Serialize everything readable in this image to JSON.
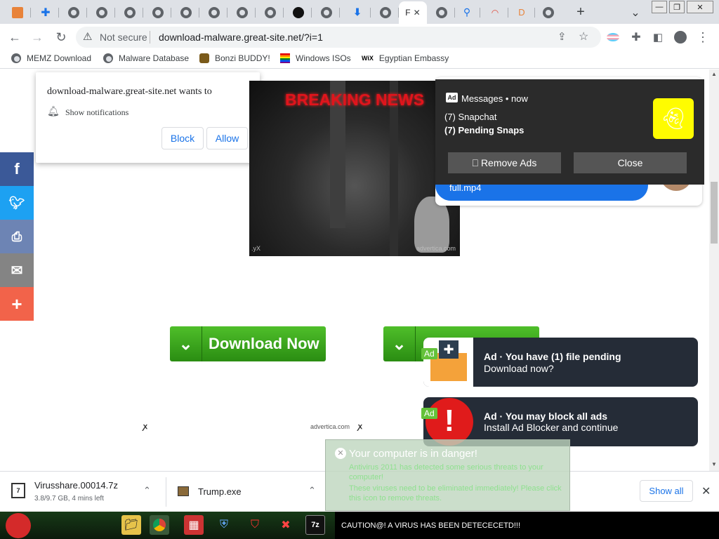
{
  "tabs": {
    "active_label": "F",
    "new_tab": "+",
    "dropdown": "⌄"
  },
  "window": {
    "minimize": "—",
    "maximize": "❐",
    "close": "✕"
  },
  "toolbar": {
    "not_secure": "Not secure",
    "url": "download-malware.great-site.net/?i=1"
  },
  "bookmarks": [
    {
      "label": "MEMZ Download",
      "icon": "globe-icon"
    },
    {
      "label": "Malware Database",
      "icon": "globe-icon"
    },
    {
      "label": "Bonzi BUDDY!",
      "icon": "bonzi-icon"
    },
    {
      "label": "Windows ISOs",
      "icon": "flag-icon"
    },
    {
      "label": "Egyptian Embassy",
      "icon": "wix-icon"
    }
  ],
  "wix_logo": "WiX",
  "notification_prompt": {
    "title": "download-malware.great-site.net wants to",
    "item": "Show notifications",
    "block": "Block",
    "allow": "Allow"
  },
  "news": {
    "headline": "BREAKING NEWS",
    "watermark": "advertica.com",
    "corner": ".yX"
  },
  "downloads_buttons": {
    "primary": "Download Now"
  },
  "advertica_label": "advertica.com",
  "messages_popup": {
    "header": "Messages • now",
    "line1": "(7) Snapchat",
    "line2": "(7) Pending Snaps",
    "remove_ads": "⎕ Remove Ads",
    "close": "Close",
    "behind_text": "full.mp4"
  },
  "ads": [
    {
      "tag": "Ad",
      "title": "Ad · You have (1) file pending",
      "subtitle": "Download now?"
    },
    {
      "tag": "Ad",
      "title": "Ad · You may block all ads",
      "subtitle": "Install Ad Blocker and continue"
    }
  ],
  "fake_av": {
    "title": "Your computer is in danger!",
    "line1": "Antivirus 2011 has detected some serious threats to your computer!",
    "line2": "These viruses need to be eliminated immediately! Please click this icon to remove threats."
  },
  "download_shelf": {
    "items": [
      {
        "name": "Virusshare.00014.7z",
        "status": "3.8/9.7 GB, 4 mins left"
      },
      {
        "name": "Trump.exe",
        "status": ""
      }
    ],
    "show_all": "Show all"
  },
  "taskbar": {
    "caution": "CAUTION@! A VIRUS HAS BEEN DETECECETD!!!",
    "sevenzip": "7z"
  },
  "colors": {
    "accent": "#1a73e8",
    "facebook": "#3b5998",
    "twitter": "#1da1f2",
    "print": "#6d84b4",
    "mail": "#848484",
    "more": "#f2634a",
    "download_green": "#3aa11f"
  }
}
